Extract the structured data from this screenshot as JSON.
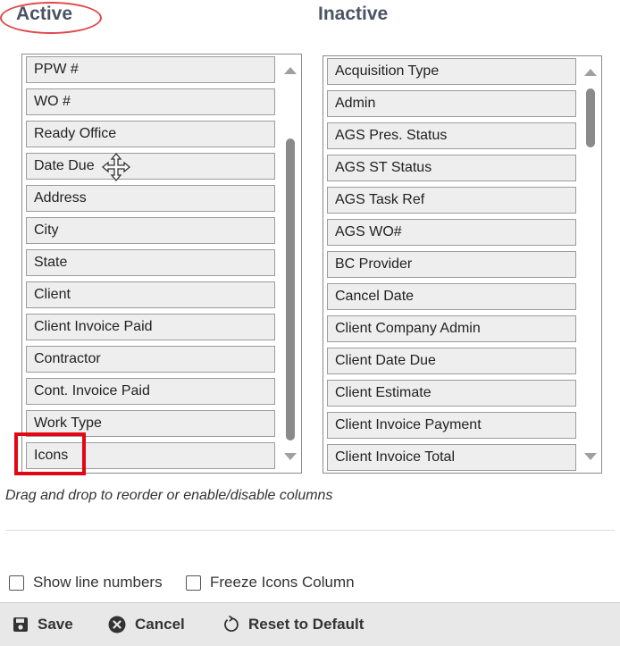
{
  "headings": {
    "active": "Active",
    "inactive": "Inactive"
  },
  "active_columns": [
    "PPW #",
    "WO #",
    "Ready Office",
    "Date Due",
    "Address",
    "City",
    "State",
    "Client",
    "Client Invoice Paid",
    "Contractor",
    "Cont. Invoice Paid",
    "Work Type",
    "Icons"
  ],
  "inactive_columns": [
    "Acquisition Type",
    "Admin",
    "AGS Pres. Status",
    "AGS ST Status",
    "AGS Task Ref",
    "AGS WO#",
    "BC Provider",
    "Cancel Date",
    "Client Company Admin",
    "Client Date Due",
    "Client Estimate",
    "Client Invoice Payment",
    "Client Invoice Total"
  ],
  "hint": "Drag and drop to reorder or enable/disable columns",
  "options": {
    "show_line_numbers": "Show line numbers",
    "freeze_icons_column": "Freeze Icons Column"
  },
  "toolbar": {
    "save": "Save",
    "cancel": "Cancel",
    "reset": "Reset to Default"
  },
  "icons": [
    "save-icon",
    "cancel-icon",
    "reset-icon",
    "move-cursor-icon"
  ],
  "colors": {
    "heading": "#4a5366",
    "highlight_red": "#e30613",
    "annotation_red": "#e04848"
  }
}
